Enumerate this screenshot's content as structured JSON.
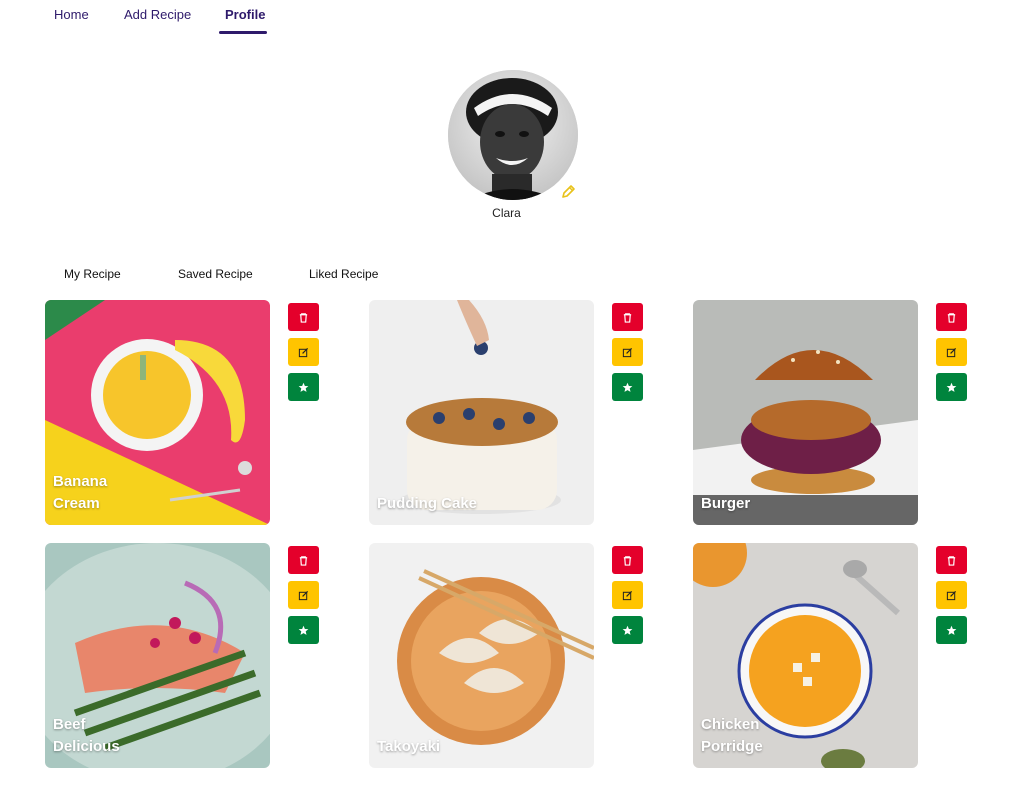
{
  "nav": {
    "items": [
      {
        "label": "Home"
      },
      {
        "label": "Add Recipe"
      },
      {
        "label": "Profile"
      }
    ],
    "active": "Profile"
  },
  "profile": {
    "name": "Clara"
  },
  "tabs": [
    {
      "label": "My Recipe"
    },
    {
      "label": "Saved Recipe"
    },
    {
      "label": "Liked Recipe"
    }
  ],
  "recipes": [
    {
      "title": "Banana Cream"
    },
    {
      "title": "Pudding Cake"
    },
    {
      "title": "Burger"
    },
    {
      "title": "Beef Delicious"
    },
    {
      "title": "Takoyaki"
    },
    {
      "title": "Chicken Porridge"
    }
  ],
  "colors": {
    "accent": "#2e1a6b",
    "delete": "#e4002b",
    "edit": "#ffc400",
    "favorite": "#00843d"
  },
  "icons": {
    "delete": "trash-icon",
    "edit": "edit-icon",
    "favorite": "star-icon",
    "avatar_edit": "pencil-icon"
  }
}
